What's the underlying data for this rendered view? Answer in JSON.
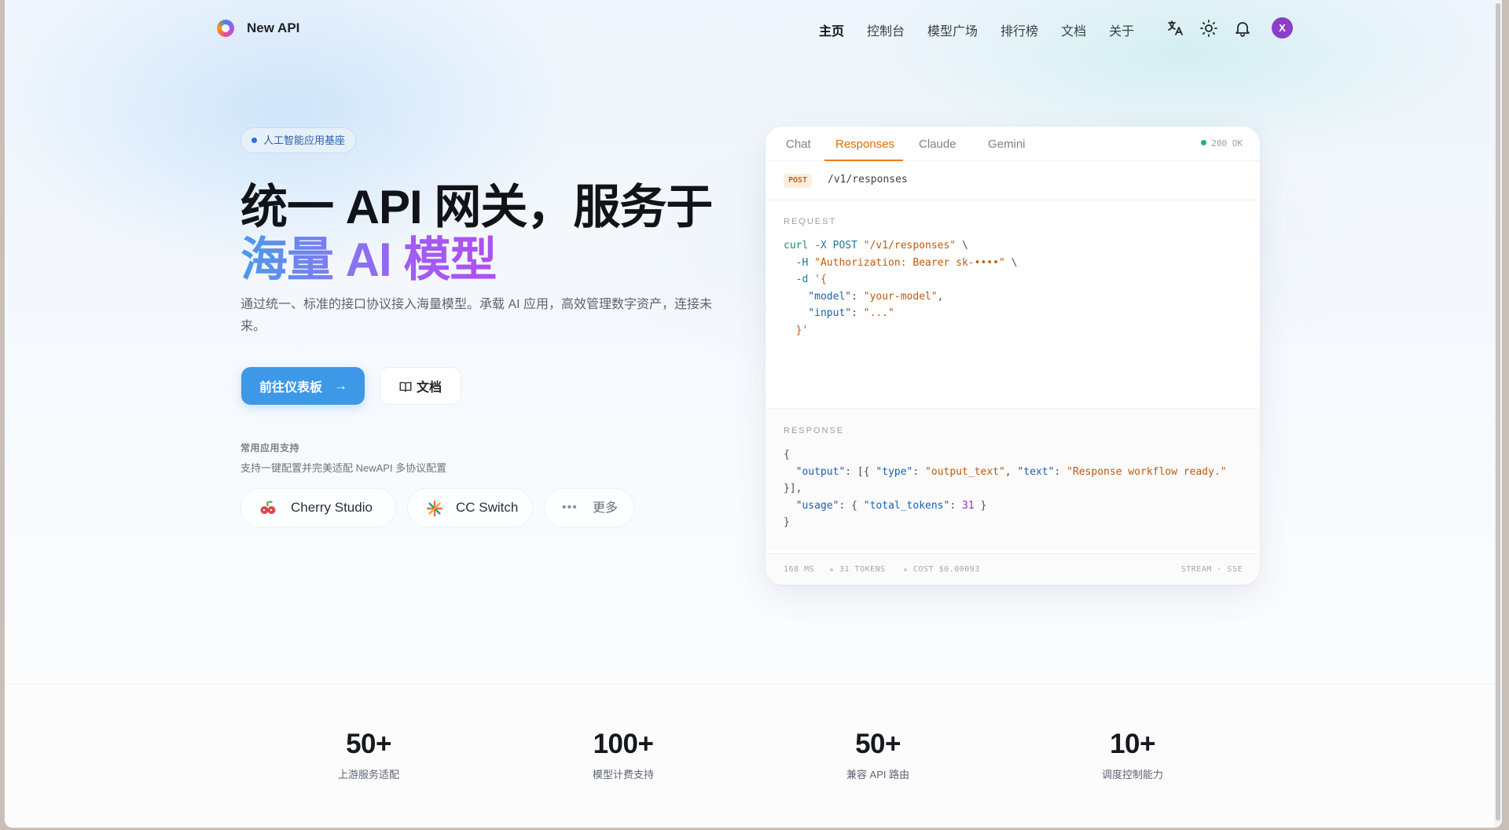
{
  "nav": {
    "brand": "New API",
    "menu": [
      "主页",
      "控制台",
      "模型广场",
      "排行榜",
      "文档",
      "关于"
    ],
    "icons": [
      "translate-icon",
      "theme-sun-icon",
      "bell-icon"
    ],
    "avatar_initial": "X",
    "avatar_color": "#8a3ec9"
  },
  "hero": {
    "badge": "人工智能应用基座",
    "headline_line1": "统一 API 网关，服务于",
    "headline_line2": "海量 AI 模型",
    "description": "通过统一、标准的接口协议接入海量模型。承载 AI 应用，高效管理数字资产，连接未来。",
    "primary_button": "前往仪表板",
    "secondary_button": "文档",
    "apps_label": "常用应用支持",
    "apps_sub": "支持一键配置并完美适配 NewAPI 多协议配置",
    "apps": [
      "Cherry Studio",
      "CC Switch",
      "更多"
    ],
    "accent_color": "#3d98e8"
  },
  "panel": {
    "tabs": [
      "Chat",
      "Responses",
      "Claude",
      "Gemini"
    ],
    "active_tab": "Responses",
    "status": "200 OK",
    "method": "POST",
    "path": "/v1/responses",
    "request_label": "REQUEST",
    "request_lines": [
      {
        "p1": "curl",
        "p2": " -X POST ",
        "p3": "\"/v1/responses\"",
        "p4": " \\"
      },
      {
        "p1": "  -H ",
        "p2": "\"Authorization: Bearer sk-••••\"",
        "p3": " \\"
      },
      {
        "p1": "  -d ",
        "p2": "'{"
      },
      {
        "p1": "    \"model\"",
        "p2": ": ",
        "p3": "\"your-model\"",
        "p4": ","
      },
      {
        "p1": "    \"input\"",
        "p2": ": ",
        "p3": "\"...\""
      },
      {
        "p1": "  }'"
      }
    ],
    "response_label": "RESPONSE",
    "response_lines": [
      {
        "p1": "{"
      },
      {
        "p1": "  \"output\"",
        "p2": ": [{ ",
        "p3": "\"type\"",
        "p4": ": ",
        "p5": "\"output_text\"",
        "p6": ", ",
        "p7": "\"text\"",
        "p8": ": ",
        "p9": "\"Response workflow ready.\""
      },
      {
        "p1": "}],"
      },
      {
        "p1": "  \"usage\"",
        "p2": ": { ",
        "p3": "\"total_tokens\"",
        "p4": ": ",
        "p5": "31",
        "p6": " }"
      },
      {
        "p1": "}"
      }
    ],
    "footer": {
      "latency": "168 MS",
      "tokens": "31 TOKENS",
      "cost": "COST $0.00093",
      "mode": "STREAM · SSE"
    }
  },
  "stats": [
    {
      "value": "50+",
      "label": "上游服务适配"
    },
    {
      "value": "100+",
      "label": "模型计费支持"
    },
    {
      "value": "50+",
      "label": "兼容 API 路由"
    },
    {
      "value": "10+",
      "label": "调度控制能力"
    }
  ]
}
